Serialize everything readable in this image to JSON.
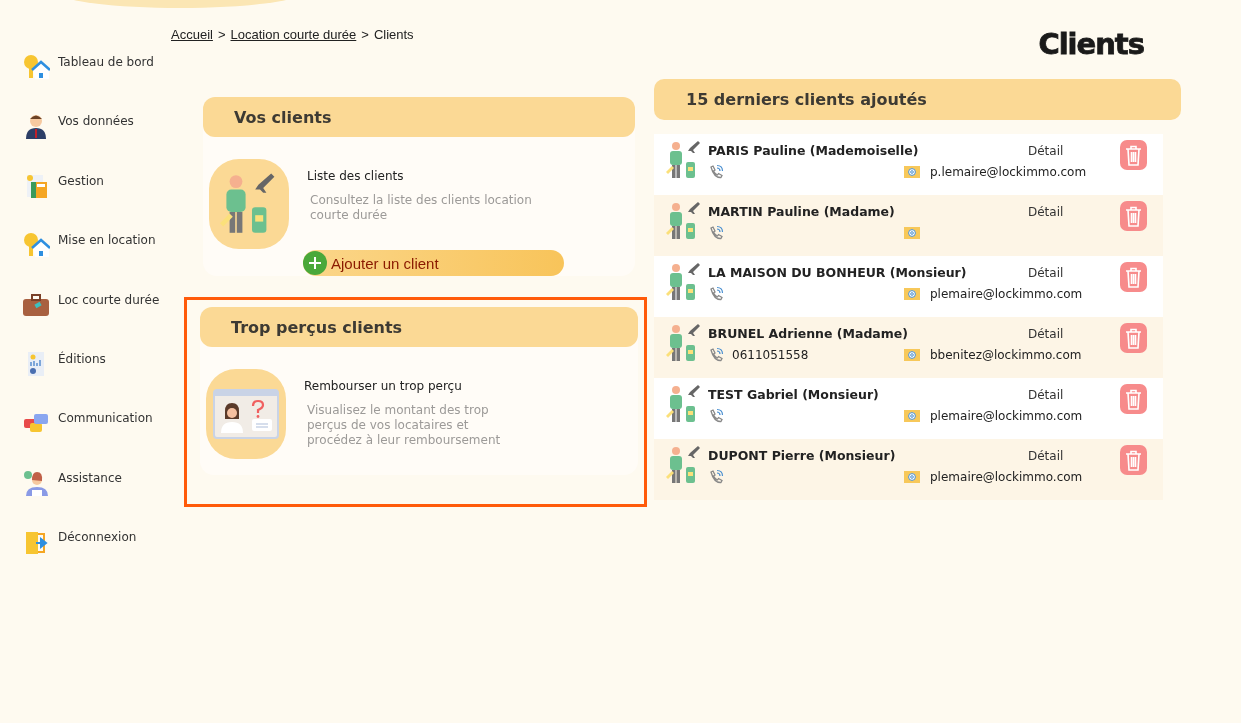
{
  "breadcrumb": [
    {
      "label": "Accueil",
      "link": true
    },
    {
      "label": ">",
      "link": false
    },
    {
      "label": "Location courte durée",
      "link": true
    },
    {
      "label": ">",
      "link": false
    },
    {
      "label": "Clients",
      "link": false
    }
  ],
  "page_title": "Clients",
  "sidebar": {
    "items": [
      {
        "label": "Tableau de bord"
      },
      {
        "label": "Vos données"
      },
      {
        "label": "Gestion"
      },
      {
        "label": "Mise en location"
      },
      {
        "label": "Loc courte durée"
      },
      {
        "label": "Éditions"
      },
      {
        "label": "Communication"
      },
      {
        "label": "Assistance"
      },
      {
        "label": "Déconnexion"
      }
    ]
  },
  "cards": [
    {
      "title": "Vos clients",
      "highlighted": false,
      "link": "Liste des clients",
      "description": "Consultez la liste des clients location courte durée",
      "button": "Ajouter un client"
    },
    {
      "title": "Trop perçus clients",
      "highlighted": true,
      "link": "Rembourser un trop perçu",
      "description": "Visualisez le montant des trop perçus de vos locataires et procédez à leur remboursement"
    }
  ],
  "recent": {
    "title": "15 derniers clients ajoutés",
    "rows": [
      {
        "name": "PARIS Pauline (Mademoiselle)",
        "detail": "Détail",
        "email": "p.lemaire@lockimmo.com"
      },
      {
        "name": "MARTIN Pauline (Madame)",
        "detail": "Détail"
      },
      {
        "name": "LA MAISON DU BONHEUR (Monsieur)",
        "detail": "Détail",
        "email": "plemaire@lockimmo.com"
      },
      {
        "name": "BRUNEL Adrienne (Madame)",
        "detail": "Détail",
        "phone": "0611051558",
        "email": "bbenitez@lockimmo.com"
      },
      {
        "name": "TEST Gabriel (Monsieur)",
        "detail": "Détail",
        "email": "plemaire@lockimmo.com"
      },
      {
        "name": "DUPONT Pierre (Monsieur)",
        "detail": "Détail",
        "email": "plemaire@lockimmo.com"
      }
    ]
  }
}
